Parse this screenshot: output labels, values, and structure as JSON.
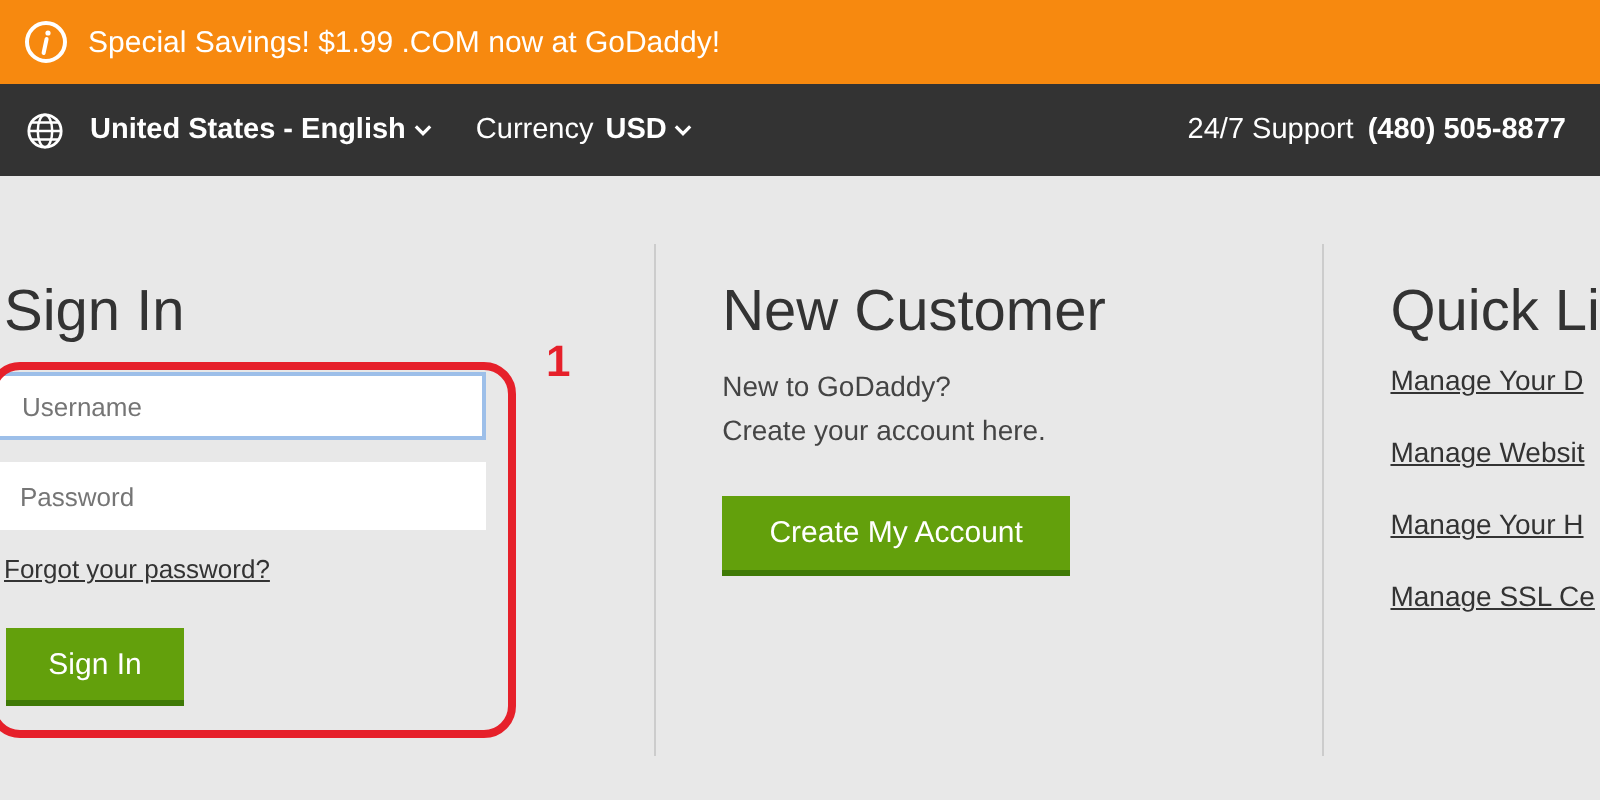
{
  "promo_bar": {
    "text": "Special Savings! $1.99 .COM now at GoDaddy!"
  },
  "top_bar": {
    "language": "United States - English",
    "currency_label": "Currency",
    "currency": "USD",
    "support_label": "24/7 Support",
    "support_phone": "(480) 505-8877"
  },
  "sign_in": {
    "title": "Sign In",
    "username": {
      "placeholder": "Username",
      "focused": true
    },
    "password": {
      "placeholder": "Password",
      "focused": false
    },
    "forgot_link": "Forgot your password?",
    "button": "Sign In"
  },
  "new_customer": {
    "title": "New Customer",
    "lines": [
      "New to GoDaddy?",
      "Create your account here."
    ],
    "button": "Create My Account"
  },
  "quick_links": {
    "title": "Quick Li",
    "links": [
      "Manage Your D",
      "Manage Websit",
      "Manage Your H",
      "Manage SSL Ce"
    ]
  },
  "annotation": {
    "label": "1"
  }
}
